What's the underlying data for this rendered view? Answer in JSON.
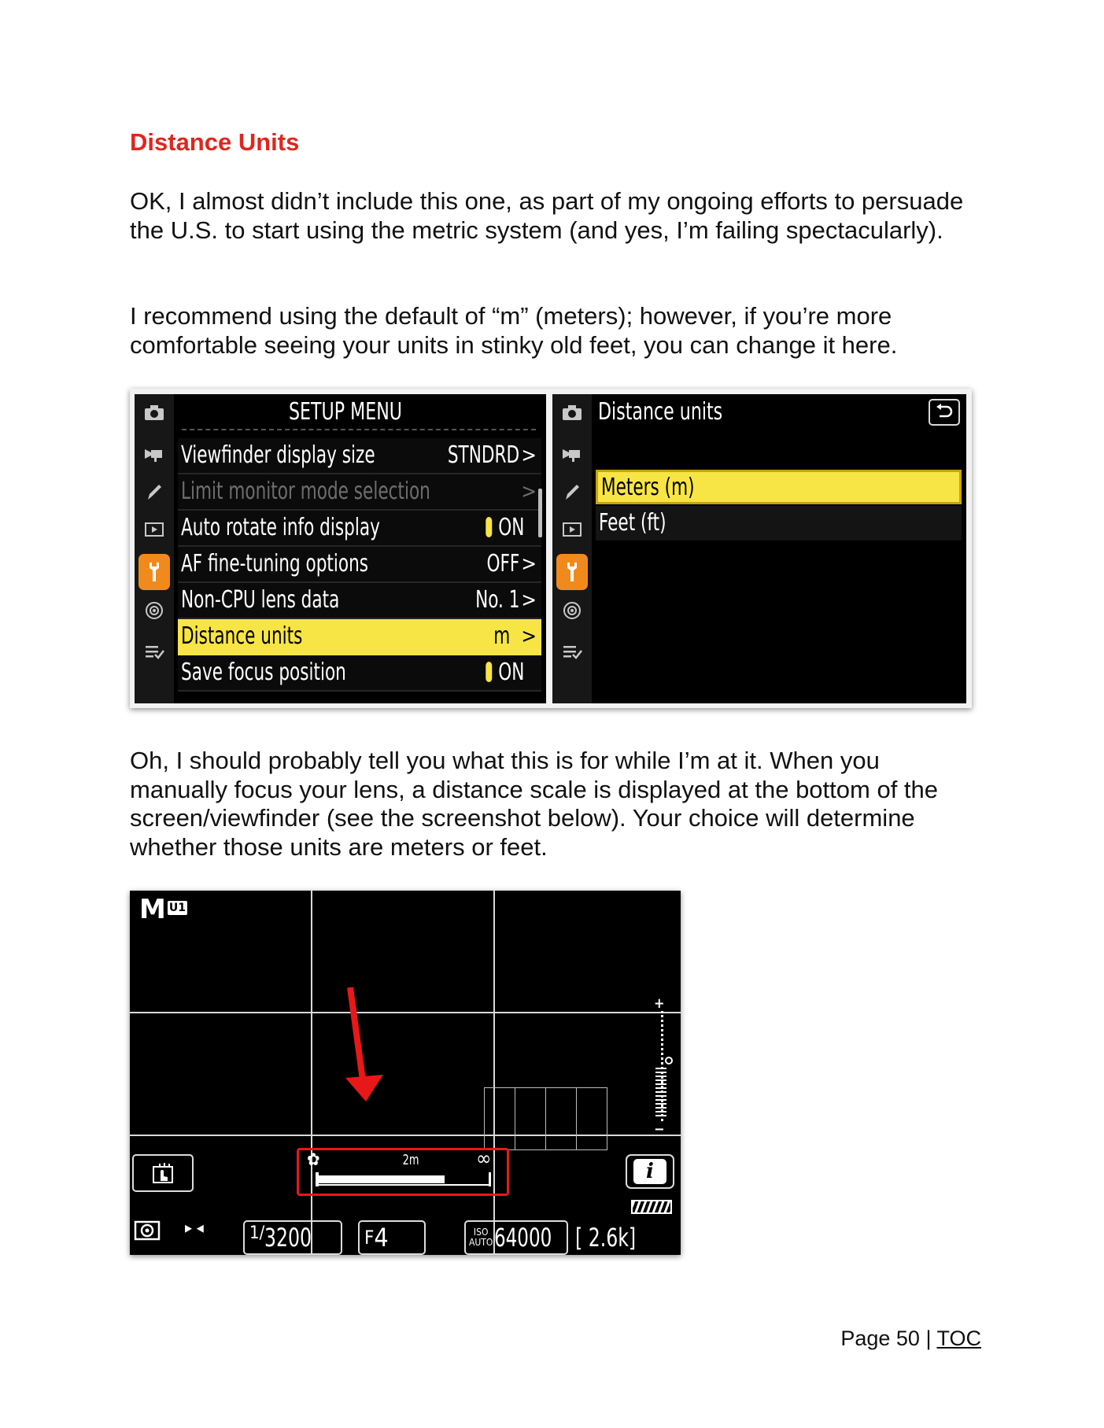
{
  "heading": "Distance Units",
  "paragraphs": [
    "OK, I almost didn’t include this one, as part of my ongoing efforts to persuade the U.S. to start using the metric system (and yes, I’m failing spectacularly).",
    "I recommend using the default of “m” (meters); however, if you’re more comfortable seeing your units in stinky old feet, you can change it here.",
    "Oh, I should probably tell you what this is for while I’m at it. When you manually focus your lens, a distance scale is displayed at the bottom of the screen/viewfinder (see the screenshot below). Your choice will determine whether those units are meters or feet."
  ],
  "setup_menu": {
    "title": "SETUP MENU",
    "icons": [
      "camera-icon",
      "movie-icon",
      "pencil-icon",
      "playback-icon",
      "wrench-icon",
      "network-icon",
      "my-menu-icon"
    ],
    "active_icon": "wrench-icon",
    "rows": [
      {
        "label": "Viewfinder display size",
        "value": "STNDRD",
        "state": "normal"
      },
      {
        "label": "Limit monitor mode selection",
        "value": "",
        "state": "disabled"
      },
      {
        "label": "Auto rotate info display",
        "value": "ON",
        "state": "toggle"
      },
      {
        "label": "AF fine-tuning options",
        "value": "OFF",
        "state": "normal"
      },
      {
        "label": "Non-CPU lens data",
        "value": "No. 1",
        "state": "normal"
      },
      {
        "label": "Distance units",
        "value": "m",
        "state": "highlighted"
      },
      {
        "label": "Save focus position",
        "value": "ON",
        "state": "toggle"
      }
    ]
  },
  "distance_menu": {
    "title": "Distance units",
    "options": [
      {
        "label": "Meters (m)",
        "selected": true
      },
      {
        "label": "Feet (ft)",
        "selected": false
      }
    ]
  },
  "viewfinder": {
    "mode": "M",
    "user_setting": "U1",
    "distance_label": "2m",
    "infinity": "∞",
    "shutter_prefix": "1/",
    "shutter": "3200",
    "aperture_prefix": "F",
    "aperture": "4",
    "iso_top": "ISO",
    "iso_bottom": "AUTO",
    "iso": "64000",
    "shots_remaining": "[ 2.6k]",
    "info_button": "i",
    "arrow_color": "#e81818"
  },
  "footer": {
    "page_text": "Page 50 | ",
    "toc_link": "TOC"
  },
  "colors": {
    "heading": "#e0261d",
    "menu_highlight": "#f7e545",
    "active_tab": "#f08a1c"
  }
}
